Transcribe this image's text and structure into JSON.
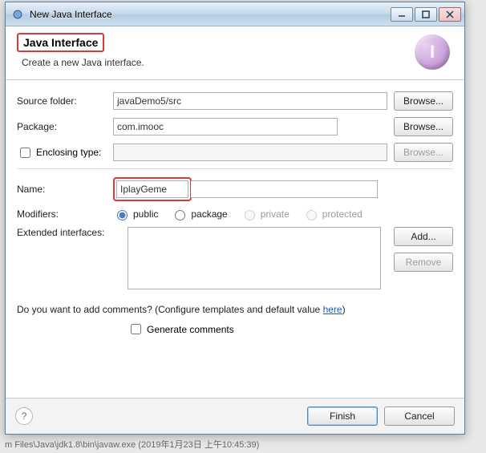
{
  "window": {
    "title": "New Java Interface"
  },
  "header": {
    "title": "Java Interface",
    "subtitle": "Create a new Java interface.",
    "icon_letter": "I"
  },
  "form": {
    "source_folder_label": "Source folder:",
    "source_folder_value": "javaDemo5/src",
    "package_label": "Package:",
    "package_value": "com.imooc",
    "enclosing_label": "Enclosing type:",
    "enclosing_checked": false,
    "enclosing_value": "",
    "name_label": "Name:",
    "name_value": "IplayGeme",
    "modifiers_label": "Modifiers:",
    "modifiers": {
      "public": "public",
      "package": "package",
      "private": "private",
      "protected": "protected",
      "selected": "public"
    },
    "extended_label": "Extended interfaces:",
    "comments_question": "Do you want to add comments? (Configure templates and default value ",
    "comments_link": "here",
    "comments_after": ")",
    "generate_label": "Generate comments",
    "generate_checked": false
  },
  "buttons": {
    "browse": "Browse...",
    "add": "Add...",
    "remove": "Remove",
    "finish": "Finish",
    "cancel": "Cancel"
  },
  "status": "m Files\\Java\\jdk1.8\\bin\\javaw.exe (2019年1月23日 上午10:45:39)"
}
